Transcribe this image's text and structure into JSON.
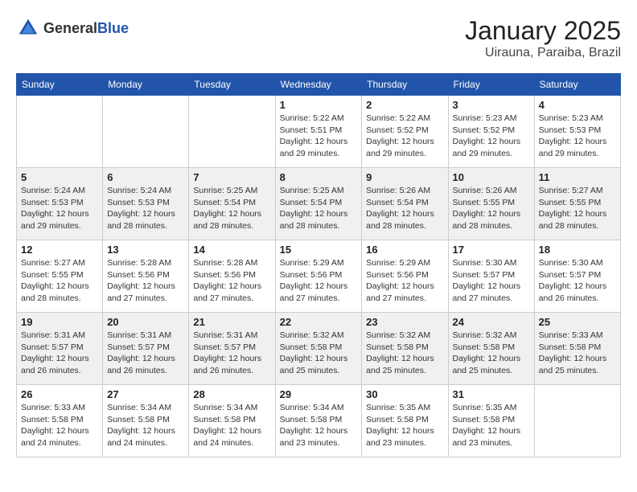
{
  "header": {
    "logo_general": "General",
    "logo_blue": "Blue",
    "month": "January 2025",
    "location": "Uirauna, Paraiba, Brazil"
  },
  "days_of_week": [
    "Sunday",
    "Monday",
    "Tuesday",
    "Wednesday",
    "Thursday",
    "Friday",
    "Saturday"
  ],
  "weeks": [
    [
      {
        "day": "",
        "sunrise": "",
        "sunset": "",
        "daylight": ""
      },
      {
        "day": "",
        "sunrise": "",
        "sunset": "",
        "daylight": ""
      },
      {
        "day": "",
        "sunrise": "",
        "sunset": "",
        "daylight": ""
      },
      {
        "day": "1",
        "sunrise": "Sunrise: 5:22 AM",
        "sunset": "Sunset: 5:51 PM",
        "daylight": "Daylight: 12 hours and 29 minutes."
      },
      {
        "day": "2",
        "sunrise": "Sunrise: 5:22 AM",
        "sunset": "Sunset: 5:52 PM",
        "daylight": "Daylight: 12 hours and 29 minutes."
      },
      {
        "day": "3",
        "sunrise": "Sunrise: 5:23 AM",
        "sunset": "Sunset: 5:52 PM",
        "daylight": "Daylight: 12 hours and 29 minutes."
      },
      {
        "day": "4",
        "sunrise": "Sunrise: 5:23 AM",
        "sunset": "Sunset: 5:53 PM",
        "daylight": "Daylight: 12 hours and 29 minutes."
      }
    ],
    [
      {
        "day": "5",
        "sunrise": "Sunrise: 5:24 AM",
        "sunset": "Sunset: 5:53 PM",
        "daylight": "Daylight: 12 hours and 29 minutes."
      },
      {
        "day": "6",
        "sunrise": "Sunrise: 5:24 AM",
        "sunset": "Sunset: 5:53 PM",
        "daylight": "Daylight: 12 hours and 28 minutes."
      },
      {
        "day": "7",
        "sunrise": "Sunrise: 5:25 AM",
        "sunset": "Sunset: 5:54 PM",
        "daylight": "Daylight: 12 hours and 28 minutes."
      },
      {
        "day": "8",
        "sunrise": "Sunrise: 5:25 AM",
        "sunset": "Sunset: 5:54 PM",
        "daylight": "Daylight: 12 hours and 28 minutes."
      },
      {
        "day": "9",
        "sunrise": "Sunrise: 5:26 AM",
        "sunset": "Sunset: 5:54 PM",
        "daylight": "Daylight: 12 hours and 28 minutes."
      },
      {
        "day": "10",
        "sunrise": "Sunrise: 5:26 AM",
        "sunset": "Sunset: 5:55 PM",
        "daylight": "Daylight: 12 hours and 28 minutes."
      },
      {
        "day": "11",
        "sunrise": "Sunrise: 5:27 AM",
        "sunset": "Sunset: 5:55 PM",
        "daylight": "Daylight: 12 hours and 28 minutes."
      }
    ],
    [
      {
        "day": "12",
        "sunrise": "Sunrise: 5:27 AM",
        "sunset": "Sunset: 5:55 PM",
        "daylight": "Daylight: 12 hours and 28 minutes."
      },
      {
        "day": "13",
        "sunrise": "Sunrise: 5:28 AM",
        "sunset": "Sunset: 5:56 PM",
        "daylight": "Daylight: 12 hours and 27 minutes."
      },
      {
        "day": "14",
        "sunrise": "Sunrise: 5:28 AM",
        "sunset": "Sunset: 5:56 PM",
        "daylight": "Daylight: 12 hours and 27 minutes."
      },
      {
        "day": "15",
        "sunrise": "Sunrise: 5:29 AM",
        "sunset": "Sunset: 5:56 PM",
        "daylight": "Daylight: 12 hours and 27 minutes."
      },
      {
        "day": "16",
        "sunrise": "Sunrise: 5:29 AM",
        "sunset": "Sunset: 5:56 PM",
        "daylight": "Daylight: 12 hours and 27 minutes."
      },
      {
        "day": "17",
        "sunrise": "Sunrise: 5:30 AM",
        "sunset": "Sunset: 5:57 PM",
        "daylight": "Daylight: 12 hours and 27 minutes."
      },
      {
        "day": "18",
        "sunrise": "Sunrise: 5:30 AM",
        "sunset": "Sunset: 5:57 PM",
        "daylight": "Daylight: 12 hours and 26 minutes."
      }
    ],
    [
      {
        "day": "19",
        "sunrise": "Sunrise: 5:31 AM",
        "sunset": "Sunset: 5:57 PM",
        "daylight": "Daylight: 12 hours and 26 minutes."
      },
      {
        "day": "20",
        "sunrise": "Sunrise: 5:31 AM",
        "sunset": "Sunset: 5:57 PM",
        "daylight": "Daylight: 12 hours and 26 minutes."
      },
      {
        "day": "21",
        "sunrise": "Sunrise: 5:31 AM",
        "sunset": "Sunset: 5:57 PM",
        "daylight": "Daylight: 12 hours and 26 minutes."
      },
      {
        "day": "22",
        "sunrise": "Sunrise: 5:32 AM",
        "sunset": "Sunset: 5:58 PM",
        "daylight": "Daylight: 12 hours and 25 minutes."
      },
      {
        "day": "23",
        "sunrise": "Sunrise: 5:32 AM",
        "sunset": "Sunset: 5:58 PM",
        "daylight": "Daylight: 12 hours and 25 minutes."
      },
      {
        "day": "24",
        "sunrise": "Sunrise: 5:32 AM",
        "sunset": "Sunset: 5:58 PM",
        "daylight": "Daylight: 12 hours and 25 minutes."
      },
      {
        "day": "25",
        "sunrise": "Sunrise: 5:33 AM",
        "sunset": "Sunset: 5:58 PM",
        "daylight": "Daylight: 12 hours and 25 minutes."
      }
    ],
    [
      {
        "day": "26",
        "sunrise": "Sunrise: 5:33 AM",
        "sunset": "Sunset: 5:58 PM",
        "daylight": "Daylight: 12 hours and 24 minutes."
      },
      {
        "day": "27",
        "sunrise": "Sunrise: 5:34 AM",
        "sunset": "Sunset: 5:58 PM",
        "daylight": "Daylight: 12 hours and 24 minutes."
      },
      {
        "day": "28",
        "sunrise": "Sunrise: 5:34 AM",
        "sunset": "Sunset: 5:58 PM",
        "daylight": "Daylight: 12 hours and 24 minutes."
      },
      {
        "day": "29",
        "sunrise": "Sunrise: 5:34 AM",
        "sunset": "Sunset: 5:58 PM",
        "daylight": "Daylight: 12 hours and 23 minutes."
      },
      {
        "day": "30",
        "sunrise": "Sunrise: 5:35 AM",
        "sunset": "Sunset: 5:58 PM",
        "daylight": "Daylight: 12 hours and 23 minutes."
      },
      {
        "day": "31",
        "sunrise": "Sunrise: 5:35 AM",
        "sunset": "Sunset: 5:58 PM",
        "daylight": "Daylight: 12 hours and 23 minutes."
      },
      {
        "day": "",
        "sunrise": "",
        "sunset": "",
        "daylight": ""
      }
    ]
  ]
}
